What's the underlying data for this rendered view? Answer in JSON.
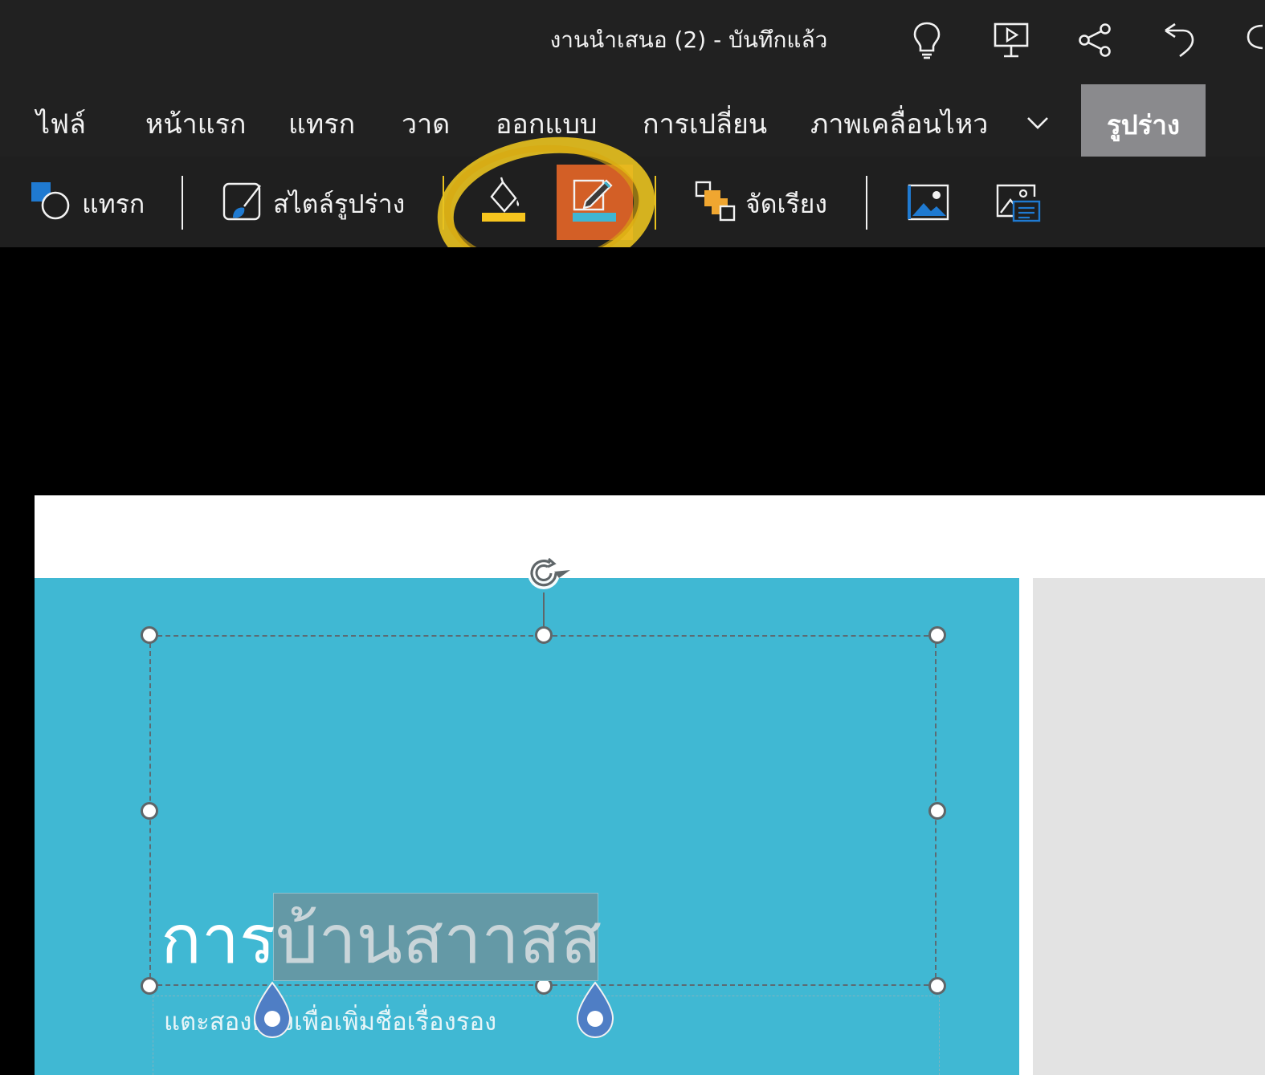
{
  "titlebar": {
    "document_title": "งานนำเสนอ (2) - บันทึกแล้ว",
    "icons": [
      "lightbulb-icon",
      "present-icon",
      "share-icon",
      "undo-icon",
      "comment-icon"
    ]
  },
  "tabs": {
    "items": [
      "ไฟล์",
      "หน้าแรก",
      "แทรก",
      "วาด",
      "ออกแบบ",
      "การเปลี่ยน",
      "ภาพเคลื่อนไหว"
    ],
    "more_icon": "chevron-down-icon",
    "active": "รูปร่าง"
  },
  "toolbar": {
    "insert_label": "แทรก",
    "shape_styles_label": "สไตล์รูปร่าง",
    "fill_icon": "shape-fill-icon",
    "outline_icon": "shape-outline-icon",
    "arrange_label": "จัดเรียง",
    "picture_icons": [
      "picture-icon",
      "alt-text-icon"
    ]
  },
  "colors": {
    "accent_orange": "#d35f26",
    "fill_yellow": "#f7c51e",
    "outline_blue": "#3fb6d2",
    "slide_blue": "#40b8d3",
    "annotation_yellow": "#e9c21f"
  },
  "slide": {
    "title_plain": "การ",
    "title_selected": "บ้านสาาสส",
    "subtitle": "แตะสองครั้งเพื่อเพิ่มชื่อเรื่องรอง"
  }
}
